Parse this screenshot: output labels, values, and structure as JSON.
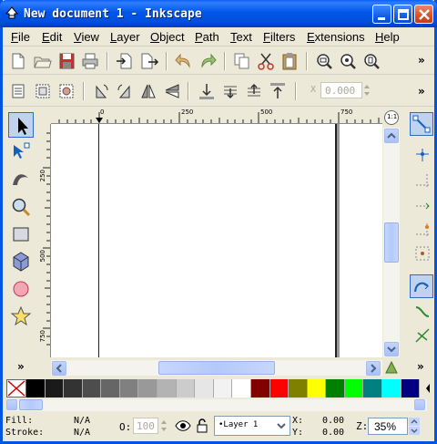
{
  "window": {
    "title": "New document 1 - Inkscape"
  },
  "menubar": {
    "items": [
      "File",
      "Edit",
      "View",
      "Layer",
      "Object",
      "Path",
      "Text",
      "Filters",
      "Extensions",
      "Help"
    ]
  },
  "toolbar2": {
    "x_label": "X",
    "x_value": "0.000"
  },
  "rulers": {
    "h_ticks": [
      "0",
      "250",
      "500",
      "750"
    ],
    "v_ticks": [
      "0",
      "250",
      "500",
      "750"
    ],
    "zoom_icon": "1:1"
  },
  "palette": {
    "colors": [
      "#000000",
      "#1a1a1a",
      "#333333",
      "#4d4d4d",
      "#666666",
      "#808080",
      "#999999",
      "#b3b3b3",
      "#cccccc",
      "#e6e6e6",
      "#f2f2f2",
      "#ffffff",
      "#800000",
      "#ff0000",
      "#808000",
      "#ffff00",
      "#008000",
      "#00ff00",
      "#008080",
      "#00ffff",
      "#000080"
    ]
  },
  "status": {
    "fill_label": "Fill:",
    "fill_value": "N/A",
    "stroke_label": "Stroke:",
    "stroke_value": "N/A",
    "opacity_label": "O:",
    "opacity_value": "100",
    "layer_value": "•Layer 1",
    "x_label": "X:",
    "x_value": "0.00",
    "y_label": "Y:",
    "y_value": "0.00",
    "zoom_label": "Z:",
    "zoom_value": "35%"
  },
  "icons": {
    "chevron": "»"
  }
}
